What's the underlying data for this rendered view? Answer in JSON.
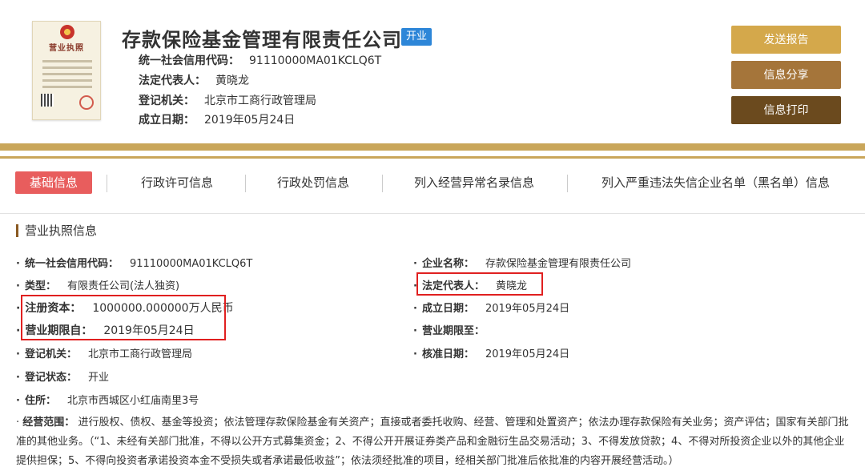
{
  "header": {
    "license_title": "营业执照",
    "company_name": "存款保险基金管理有限责任公司",
    "status": "开业",
    "credit_code_label": "统一社会信用代码：",
    "credit_code": "91110000MA01KCLQ6T",
    "legal_rep_label": "法定代表人：",
    "legal_rep": "黄晓龙",
    "registry_label": "登记机关：",
    "registry": "北京市工商行政管理局",
    "founded_label": "成立日期：",
    "founded": "2019年05月24日"
  },
  "actions": {
    "send_report": "发送报告",
    "share_info": "信息分享",
    "print_info": "信息打印"
  },
  "tabs": [
    {
      "label": "基础信息"
    },
    {
      "label": "行政许可信息"
    },
    {
      "label": "行政处罚信息"
    },
    {
      "label": "列入经营异常名录信息"
    },
    {
      "label": "列入严重违法失信企业名单（黑名单）信息"
    }
  ],
  "section": {
    "title": "营业执照信息"
  },
  "fields": {
    "credit_code": {
      "label": "统一社会信用代码：",
      "value": "91110000MA01KCLQ6T"
    },
    "company_name": {
      "label": "企业名称：",
      "value": "存款保险基金管理有限责任公司"
    },
    "type": {
      "label": "类型：",
      "value": "有限责任公司(法人独资)"
    },
    "legal_rep": {
      "label": "法定代表人：",
      "value": "黄晓龙"
    },
    "capital": {
      "label": "注册资本：",
      "value": "1000000.000000万人民币"
    },
    "founded": {
      "label": "成立日期：",
      "value": "2019年05月24日"
    },
    "term_from": {
      "label": "营业期限自：",
      "value": "2019年05月24日"
    },
    "term_to": {
      "label": "营业期限至：",
      "value": ""
    },
    "registry": {
      "label": "登记机关：",
      "value": "北京市工商行政管理局"
    },
    "approved": {
      "label": "核准日期：",
      "value": "2019年05月24日"
    },
    "reg_status": {
      "label": "登记状态：",
      "value": "开业"
    },
    "address": {
      "label": "住所：",
      "value": "北京市西城区小红庙南里3号"
    },
    "scope": {
      "label": "经营范围：",
      "value": "进行股权、债权、基金等投资；依法管理存款保险基金有关资产；直接或者委托收购、经营、管理和处置资产；依法办理存款保险有关业务；资产评估；国家有关部门批准的其他业务。（“1、未经有关部门批准，不得以公开方式募集资金；2、不得公开开展证券类产品和金融衍生品交易活动；3、不得发放贷款；4、不得对所投资企业以外的其他企业提供担保；5、不得向投资者承诺投资本金不受损失或者承诺最低收益”；依法须经批准的项目，经相关部门批准后依批准的内容开展经营活动。）"
    }
  },
  "colors": {
    "gold": "#c9a65a",
    "active_tab": "#e85d5d",
    "badge": "#2d86d8",
    "highlight": "#e02020"
  }
}
